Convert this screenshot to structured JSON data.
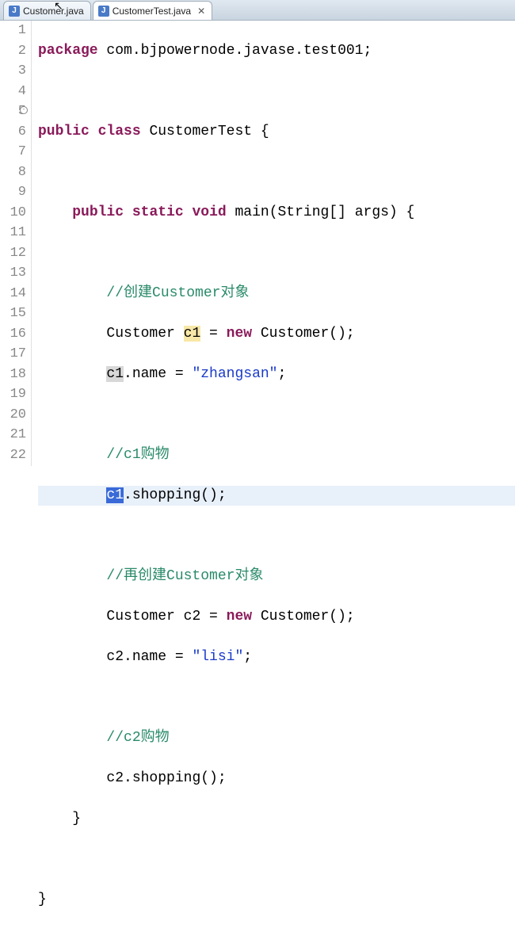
{
  "tabs": [
    {
      "label": "Customer.java",
      "active": false,
      "closeable": false
    },
    {
      "label": "CustomerTest.java",
      "active": true,
      "closeable": true
    }
  ],
  "gutter": {
    "lines": [
      "1",
      "2",
      "3",
      "4",
      "5",
      "6",
      "7",
      "8",
      "9",
      "10",
      "11",
      "12",
      "13",
      "14",
      "15",
      "16",
      "17",
      "18",
      "19",
      "20",
      "21",
      "22"
    ],
    "foldable_marker_at": "5"
  },
  "code": {
    "l1_kw": "package",
    "l1_rest": " com.bjpowernode.javase.test001;",
    "l3_kw1": "public",
    "l3_kw2": "class",
    "l3_rest": " CustomerTest {",
    "l5_kw1": "public",
    "l5_kw2": "static",
    "l5_kw3": "void",
    "l5_rest": " main(String[] args) {",
    "l7_cmt": "//创建Customer对象",
    "l8_a": "Customer ",
    "l8_hl": "c1",
    "l8_b": " = ",
    "l8_kw": "new",
    "l8_c": " Customer();",
    "l9_hl": "c1",
    "l9_a": ".name = ",
    "l9_str": "\"zhangsan\"",
    "l9_b": ";",
    "l11_cmt": "//c1购物",
    "l12_sel": "c1",
    "l12_a": ".shopping();",
    "l14_cmt": "//再创建Customer对象",
    "l15_a": "Customer c2 = ",
    "l15_kw": "new",
    "l15_b": " Customer();",
    "l16_a": "c2.name = ",
    "l16_str": "\"lisi\"",
    "l16_b": ";",
    "l18_cmt": "//c2购物",
    "l19_a": "c2.shopping();",
    "l20": "}",
    "l22": "}",
    "indent1": "    ",
    "indent2": "        "
  }
}
